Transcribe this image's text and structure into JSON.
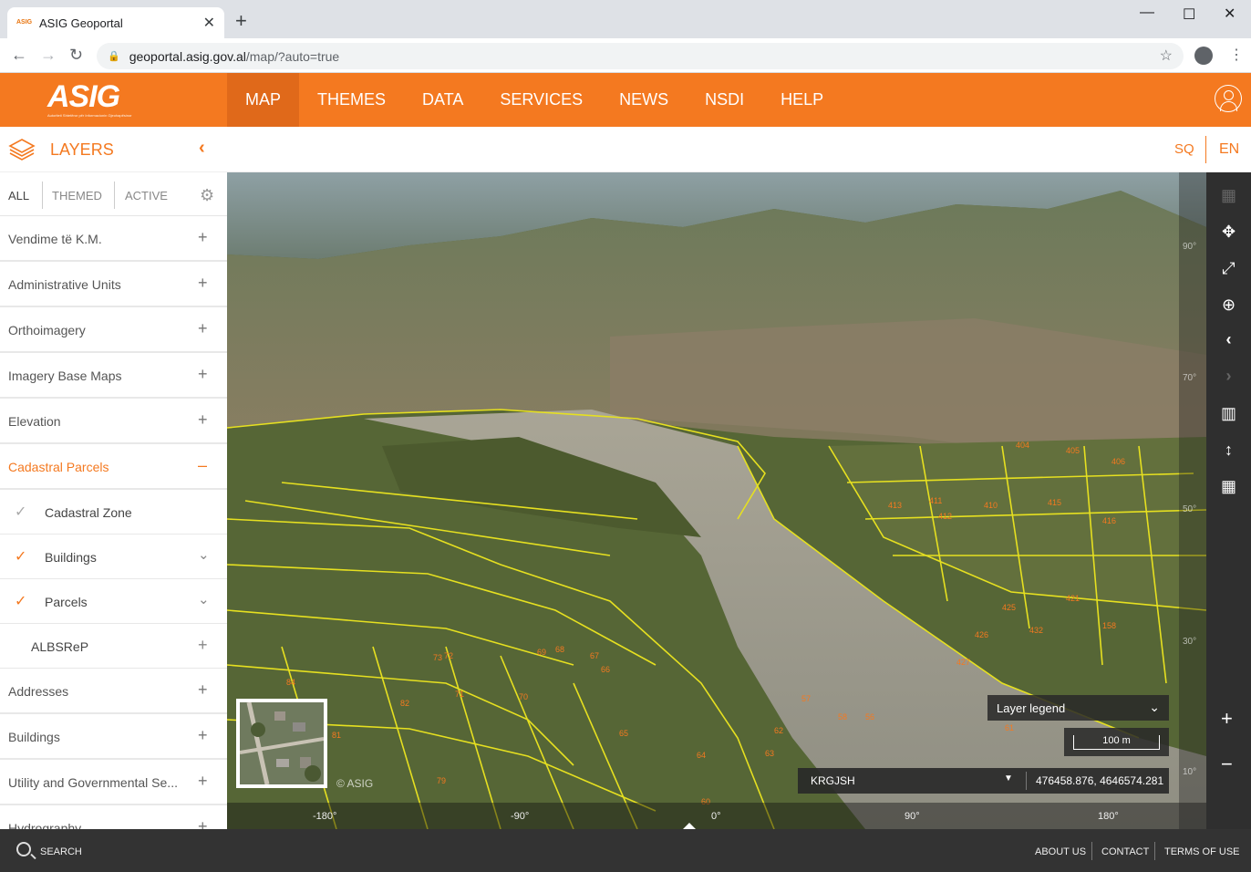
{
  "browser": {
    "tab_title": "ASIG Geoportal",
    "favicon_text": "ASIG",
    "url_domain": "geoportal.asig.gov.al",
    "url_path": "/map/?auto=true"
  },
  "header": {
    "logo_text": "ASIG",
    "logo_subtitle": "Autoriteti Shtetëror për Informacionin Gjeohapësinor",
    "nav": [
      "MAP",
      "THEMES",
      "DATA",
      "SERVICES",
      "NEWS",
      "NSDI",
      "HELP"
    ],
    "active_nav": "MAP",
    "accent_color": "#f47920"
  },
  "layersbar": {
    "title": "LAYERS",
    "lang_sq": "SQ",
    "lang_en": "EN"
  },
  "sidebar": {
    "tabs": [
      "ALL",
      "THEMED",
      "ACTIVE"
    ],
    "rows": [
      {
        "label": "Vendime të K.M.",
        "action": "+"
      },
      {
        "label": "Administrative Units",
        "action": "+"
      },
      {
        "label": "Orthoimagery",
        "action": "+"
      },
      {
        "label": "Imagery Base Maps",
        "action": "+"
      },
      {
        "label": "Elevation",
        "action": "+"
      },
      {
        "label": "Cadastral Parcels",
        "action": "–"
      }
    ],
    "subitems": [
      {
        "label": "Cadastral Zone",
        "checked": true,
        "check_color": "#aaaaaa"
      },
      {
        "label": "Buildings",
        "checked": true,
        "check_color": "#f47920",
        "action": "⌄"
      },
      {
        "label": "Parcels",
        "checked": true,
        "check_color": "#f47920",
        "action": "⌄"
      }
    ],
    "albsrep": {
      "label": "ALBSReP",
      "action": "+"
    },
    "rows_after": [
      {
        "label": "Addresses",
        "action": "+"
      },
      {
        "label": "Buildings",
        "action": "+"
      },
      {
        "label": "Utility and Governmental Se...",
        "action": "+"
      },
      {
        "label": "Hydrography",
        "action": "+"
      }
    ]
  },
  "map": {
    "copyright": "© ASIG",
    "legend_label": "Layer legend",
    "scale_label": "100 m",
    "crs_name": "KRGJSH",
    "coordinates": "476458.876, 4646574.281",
    "longitude_ticks": [
      "-180°",
      "-90°",
      "0°",
      "90°",
      "180°"
    ],
    "latitude_ticks": [
      "90°",
      "70°",
      "50°",
      "30°",
      "10°"
    ],
    "parcel_labels": [
      "404",
      "405",
      "406",
      "410",
      "411",
      "412",
      "413",
      "415",
      "416",
      "421",
      "425",
      "426",
      "427",
      "432",
      "158",
      "61",
      "62",
      "63",
      "64",
      "65",
      "66",
      "67",
      "68",
      "69",
      "70",
      "71",
      "72",
      "73",
      "79",
      "81",
      "82",
      "84",
      "56",
      "57",
      "58",
      "60"
    ]
  },
  "tools": [
    "layers-map-icon",
    "fullscreen-icon",
    "expand-icon",
    "zoom-icon",
    "back-icon",
    "forward-icon",
    "map-icon",
    "height-icon",
    "grid-icon"
  ],
  "footer": {
    "search": "SEARCH",
    "links": [
      "ABOUT US",
      "CONTACT",
      "TERMS OF USE"
    ]
  }
}
